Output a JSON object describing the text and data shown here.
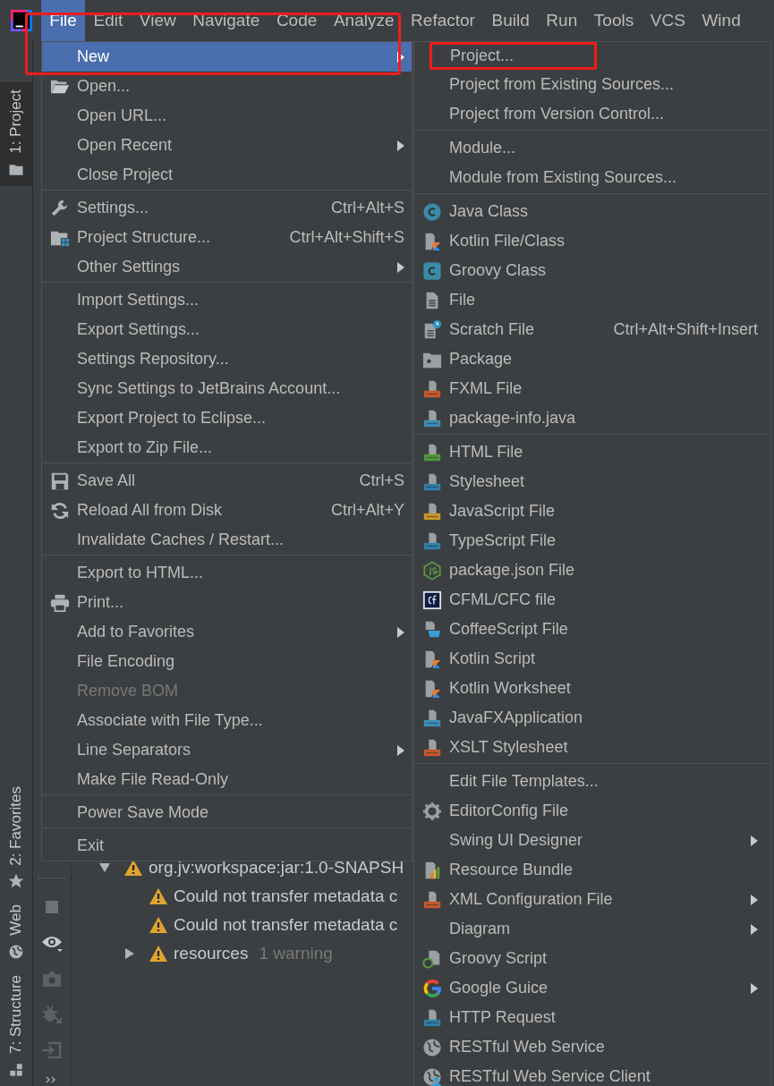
{
  "menubar": [
    {
      "label": "File",
      "selected": true
    },
    {
      "label": "Edit",
      "selected": false
    },
    {
      "label": "View",
      "selected": false
    },
    {
      "label": "Navigate",
      "selected": false
    },
    {
      "label": "Code",
      "selected": false
    },
    {
      "label": "Analyze",
      "selected": false
    },
    {
      "label": "Refactor",
      "selected": false
    },
    {
      "label": "Build",
      "selected": false
    },
    {
      "label": "Run",
      "selected": false
    },
    {
      "label": "Tools",
      "selected": false
    },
    {
      "label": "VCS",
      "selected": false
    },
    {
      "label": "Wind",
      "selected": false
    }
  ],
  "file_menu": {
    "annotated": true,
    "groups": [
      [
        {
          "label": "New",
          "selected": true,
          "disabled": false,
          "has_submenu": true
        },
        {
          "label": "Open...",
          "selected": false,
          "disabled": false,
          "has_submenu": false
        },
        {
          "label": "Open URL...",
          "selected": false,
          "disabled": false,
          "has_submenu": false
        },
        {
          "label": "Open Recent",
          "selected": false,
          "disabled": false,
          "has_submenu": true
        },
        {
          "label": "Close Project",
          "selected": false,
          "disabled": false,
          "has_submenu": false
        }
      ],
      [
        {
          "label": "Settings...",
          "shortcut": "Ctrl+Alt+S",
          "selected": false,
          "disabled": false,
          "has_submenu": false
        },
        {
          "label": "Project Structure...",
          "shortcut": "Ctrl+Alt+Shift+S",
          "selected": false,
          "disabled": false,
          "has_submenu": false
        },
        {
          "label": "Other Settings",
          "selected": false,
          "disabled": false,
          "has_submenu": true
        }
      ],
      [
        {
          "label": "Import Settings...",
          "selected": false,
          "disabled": false,
          "has_submenu": false
        },
        {
          "label": "Export Settings...",
          "selected": false,
          "disabled": false,
          "has_submenu": false
        },
        {
          "label": "Settings Repository...",
          "selected": false,
          "disabled": false,
          "has_submenu": false
        },
        {
          "label": "Sync Settings to JetBrains Account...",
          "selected": false,
          "disabled": false,
          "has_submenu": false
        },
        {
          "label": "Export Project to Eclipse...",
          "selected": false,
          "disabled": false,
          "has_submenu": false
        },
        {
          "label": "Export to Zip File...",
          "selected": false,
          "disabled": false,
          "has_submenu": false
        }
      ],
      [
        {
          "label": "Save All",
          "shortcut": "Ctrl+S",
          "selected": false,
          "disabled": false,
          "has_submenu": false
        },
        {
          "label": "Reload All from Disk",
          "shortcut": "Ctrl+Alt+Y",
          "selected": false,
          "disabled": false,
          "has_submenu": false
        },
        {
          "label": "Invalidate Caches / Restart...",
          "selected": false,
          "disabled": false,
          "has_submenu": false
        }
      ],
      [
        {
          "label": "Export to HTML...",
          "selected": false,
          "disabled": false,
          "has_submenu": false
        },
        {
          "label": "Print...",
          "selected": false,
          "disabled": false,
          "has_submenu": false
        },
        {
          "label": "Add to Favorites",
          "selected": false,
          "disabled": false,
          "has_submenu": true
        },
        {
          "label": "File Encoding",
          "selected": false,
          "disabled": false,
          "has_submenu": false
        },
        {
          "label": "Remove BOM",
          "selected": false,
          "disabled": true,
          "has_submenu": false
        },
        {
          "label": "Associate with File Type...",
          "selected": false,
          "disabled": false,
          "has_submenu": false
        },
        {
          "label": "Line Separators",
          "selected": false,
          "disabled": false,
          "has_submenu": true
        },
        {
          "label": "Make File Read-Only",
          "selected": false,
          "disabled": false,
          "has_submenu": false
        }
      ],
      [
        {
          "label": "Power Save Mode",
          "selected": false,
          "disabled": false,
          "has_submenu": false
        }
      ],
      [
        {
          "label": "Exit",
          "selected": false,
          "disabled": false,
          "has_submenu": false
        }
      ]
    ]
  },
  "new_submenu": {
    "groups": [
      [
        {
          "label": "Project...",
          "annotated": true,
          "has_submenu": false
        },
        {
          "label": "Project from Existing Sources...",
          "annotated": false,
          "has_submenu": false
        },
        {
          "label": "Project from Version Control...",
          "annotated": false,
          "has_submenu": false
        }
      ],
      [
        {
          "label": "Module...",
          "annotated": false,
          "has_submenu": false
        },
        {
          "label": "Module from Existing Sources...",
          "annotated": false,
          "has_submenu": false
        }
      ],
      [
        {
          "label": "Java Class",
          "annotated": false,
          "has_submenu": false
        },
        {
          "label": "Kotlin File/Class",
          "annotated": false,
          "has_submenu": false
        },
        {
          "label": "Groovy Class",
          "annotated": false,
          "has_submenu": false
        },
        {
          "label": "File",
          "annotated": false,
          "has_submenu": false
        },
        {
          "label": "Scratch File",
          "shortcut": "Ctrl+Alt+Shift+Insert",
          "annotated": false,
          "has_submenu": false
        },
        {
          "label": "Package",
          "annotated": false,
          "has_submenu": false
        },
        {
          "label": "FXML File",
          "annotated": false,
          "has_submenu": false
        },
        {
          "label": "package-info.java",
          "annotated": false,
          "has_submenu": false
        }
      ],
      [
        {
          "label": "HTML File",
          "annotated": false,
          "has_submenu": false
        },
        {
          "label": "Stylesheet",
          "annotated": false,
          "has_submenu": false
        },
        {
          "label": "JavaScript File",
          "annotated": false,
          "has_submenu": false
        },
        {
          "label": "TypeScript File",
          "annotated": false,
          "has_submenu": false
        },
        {
          "label": "package.json File",
          "annotated": false,
          "has_submenu": false
        },
        {
          "label": "CFML/CFC file",
          "annotated": false,
          "has_submenu": false
        },
        {
          "label": "CoffeeScript File",
          "annotated": false,
          "has_submenu": false
        },
        {
          "label": "Kotlin Script",
          "annotated": false,
          "has_submenu": false
        },
        {
          "label": "Kotlin Worksheet",
          "annotated": false,
          "has_submenu": false
        },
        {
          "label": "JavaFXApplication",
          "annotated": false,
          "has_submenu": false
        },
        {
          "label": "XSLT Stylesheet",
          "annotated": false,
          "has_submenu": false
        }
      ],
      [
        {
          "label": "Edit File Templates...",
          "annotated": false,
          "has_submenu": false
        },
        {
          "label": "EditorConfig File",
          "annotated": false,
          "has_submenu": false
        },
        {
          "label": "Swing UI Designer",
          "annotated": false,
          "has_submenu": true
        },
        {
          "label": "Resource Bundle",
          "annotated": false,
          "has_submenu": false
        },
        {
          "label": "XML Configuration File",
          "annotated": false,
          "has_submenu": true
        },
        {
          "label": "Diagram",
          "annotated": false,
          "has_submenu": true
        },
        {
          "label": "Groovy Script",
          "annotated": false,
          "has_submenu": false
        },
        {
          "label": "Google Guice",
          "annotated": false,
          "has_submenu": true
        },
        {
          "label": "HTTP Request",
          "annotated": false,
          "has_submenu": false
        },
        {
          "label": "RESTful Web Service",
          "annotated": false,
          "has_submenu": false
        },
        {
          "label": "RESTful Web Service Client",
          "annotated": false,
          "has_submenu": false
        }
      ]
    ]
  },
  "tool_windows": [
    {
      "label": "1: Project",
      "selected": true
    },
    {
      "label": "2: Favorites",
      "selected": false
    },
    {
      "label": "Web",
      "selected": false
    },
    {
      "label": "7: Structure",
      "selected": false
    }
  ],
  "tree": [
    {
      "label": "org.jv:workspace:jar:1.0-SNAPSH",
      "expanded": true,
      "children": [
        {
          "label": "Could not transfer metadata c"
        },
        {
          "label": "Could not transfer metadata c"
        },
        {
          "label": "resources",
          "note": "1 warning",
          "expanded": false
        }
      ]
    }
  ]
}
